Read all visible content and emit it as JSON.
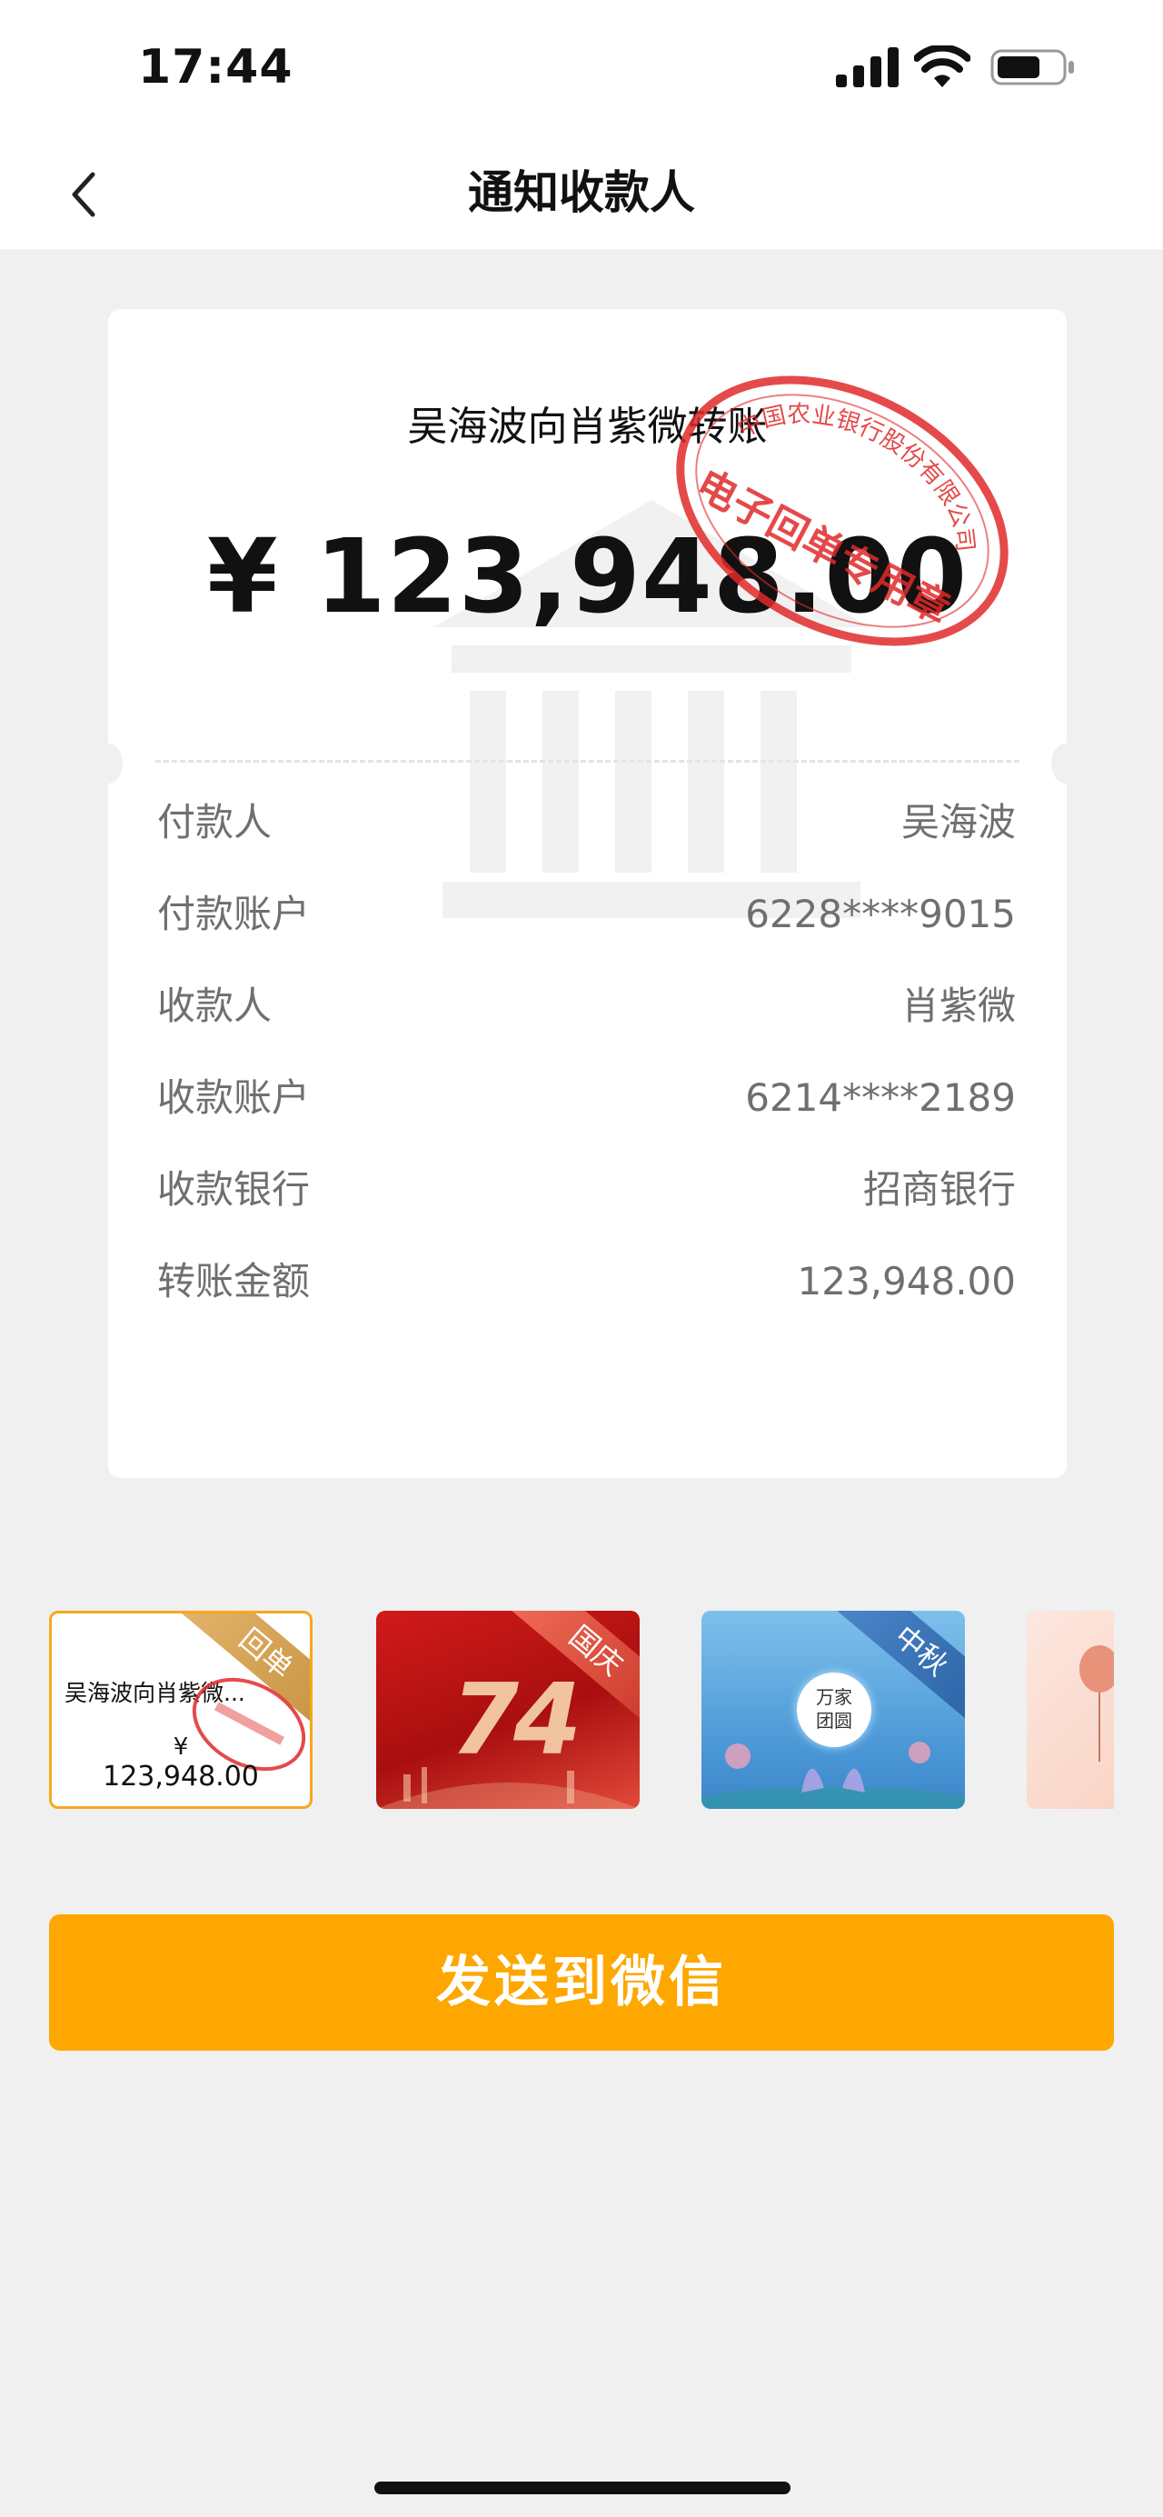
{
  "status_bar": {
    "time": "17:44"
  },
  "nav": {
    "title": "通知收款人"
  },
  "receipt": {
    "title": "吴海波向肖紫微转账",
    "amount": "¥ 123,948.00",
    "stamp_top": "中国农业银行股份有限公司",
    "stamp_bottom": "电子回单专用章",
    "rows": [
      {
        "label": "付款人",
        "value": "吴海波"
      },
      {
        "label": "付款账户",
        "value": "6228****9015"
      },
      {
        "label": "收款人",
        "value": "肖紫微"
      },
      {
        "label": "收款账户",
        "value": "6214****2189"
      },
      {
        "label": "收款银行",
        "value": "招商银行"
      },
      {
        "label": "转账金额",
        "value": "123,948.00"
      }
    ]
  },
  "templates": [
    {
      "tag": "回单",
      "title": "吴海波向肖紫微...",
      "yen": "¥",
      "amount": "123,948.00"
    },
    {
      "tag": "国庆",
      "graphic_text": "74"
    },
    {
      "tag": "中秋",
      "graphic_text": "万家\n团圆"
    },
    {
      "tag": ""
    }
  ],
  "send_button": {
    "label": "发送到微信"
  },
  "colors": {
    "accent": "#fda700",
    "stamp_red": "#e02a2a",
    "selected_border": "#f7a81b"
  },
  "icons": [
    "signal-icon",
    "wifi-icon",
    "battery-icon",
    "back-chevron-icon"
  ]
}
